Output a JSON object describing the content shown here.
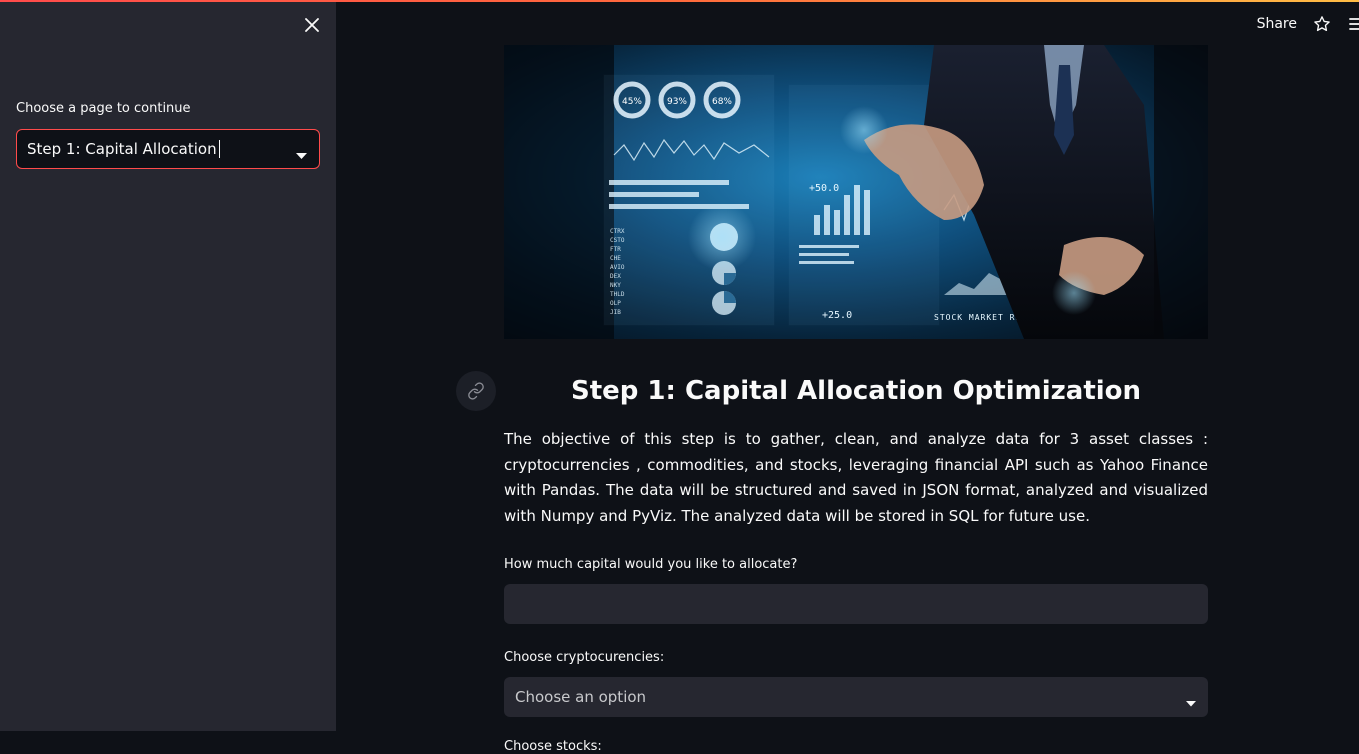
{
  "header": {
    "share_label": "Share",
    "star_icon": "star-icon",
    "menu_icon": "hamburger-menu-icon",
    "accent_gradient": [
      "#ff4b4b",
      "#ffbd45"
    ]
  },
  "sidebar": {
    "close_icon": "close-icon",
    "select_label": "Choose a page to continue",
    "selected_page": "Step 1: Capital Allocation",
    "accent_color": "#ff4b4b"
  },
  "hero": {
    "gauges": [
      "45%",
      "93%",
      "68%"
    ],
    "chart_value_a": "+50.0",
    "chart_value_b": "+25.0",
    "report_label": "STOCK MARKET REPORT",
    "ticker_list": [
      "CTRX",
      "CSTO",
      "FTR",
      "CHE",
      "AVIO",
      "DEX",
      "NKY",
      "THLD",
      "OLP",
      "JIB"
    ]
  },
  "main": {
    "title": "Step 1: Capital Allocation Optimization",
    "description": "The objective of this step is to gather, clean, and analyze data for 3 asset classes : cryptocurrencies , commodities, and stocks, leveraging financial API such as Yahoo Finance with Pandas. The data will be structured and saved in JSON format, analyzed and visualized with Numpy and PyViz. The analyzed data will be stored in SQL for future use.",
    "capital_label": "How much capital would you like to allocate?",
    "capital_value": "",
    "crypto_label": "Choose cryptocurencies:",
    "crypto_placeholder": "Choose an option",
    "stocks_label": "Choose stocks:"
  },
  "colors": {
    "background": "#0e1117",
    "sidebar": "#262730",
    "input": "#262730",
    "text": "#fafafa"
  }
}
